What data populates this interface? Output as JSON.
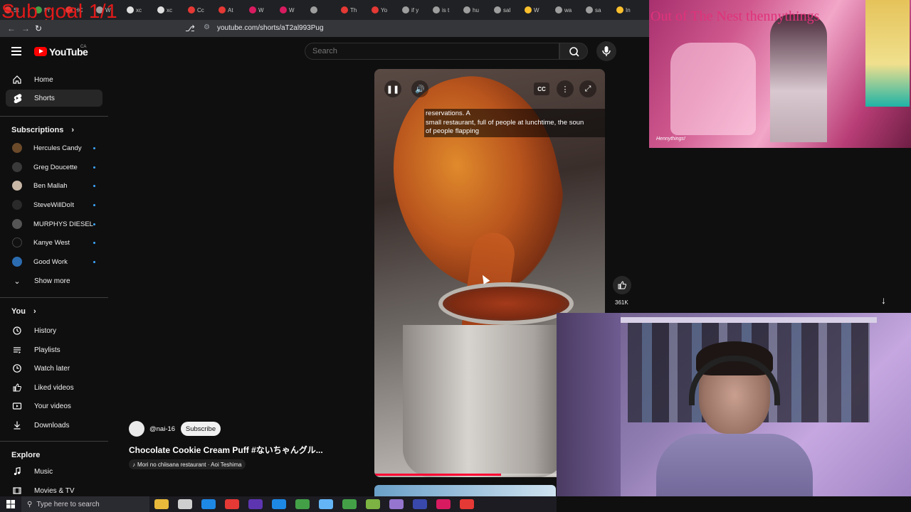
{
  "browser": {
    "tabs": [
      "St",
      "Pr",
      "HC",
      "W",
      "xc",
      "xc",
      "Cc",
      "At",
      "W",
      "W",
      "",
      "Th",
      "Yo",
      "if y",
      "is t",
      "hu",
      "sal",
      "W",
      "wa",
      "sa",
      "In"
    ],
    "url": "youtube.com/shorts/aT2al993Pug",
    "overlay_text": "Sub goal 1/1"
  },
  "youtube": {
    "logo": "YouTube",
    "region": "CA",
    "search_placeholder": "Search"
  },
  "sidebar": {
    "main": [
      {
        "label": "Home",
        "icon": "home-icon"
      },
      {
        "label": "Shorts",
        "icon": "shorts-icon"
      }
    ],
    "subscriptions_title": "Subscriptions",
    "subscriptions": [
      {
        "label": "Hercules Candy",
        "color": "#6b4a2a"
      },
      {
        "label": "Greg Doucette",
        "color": "#3a3a3a"
      },
      {
        "label": "Ben Mallah",
        "color": "#c9b7a6"
      },
      {
        "label": "SteveWillDoIt",
        "color": "#2a2a2a"
      },
      {
        "label": "MURPHYS DIESEL",
        "color": "#555555"
      },
      {
        "label": "Kanye West",
        "color": "#111111"
      },
      {
        "label": "Good Work",
        "color": "#2b6cb0"
      }
    ],
    "show_more": "Show more",
    "you_title": "You",
    "you_items": [
      {
        "label": "History",
        "icon": "history-icon"
      },
      {
        "label": "Playlists",
        "icon": "playlists-icon"
      },
      {
        "label": "Watch later",
        "icon": "watch-later-icon"
      },
      {
        "label": "Liked videos",
        "icon": "liked-videos-icon"
      },
      {
        "label": "Your videos",
        "icon": "your-videos-icon"
      },
      {
        "label": "Downloads",
        "icon": "downloads-icon"
      }
    ],
    "explore_title": "Explore",
    "explore_items": [
      {
        "label": "Music",
        "icon": "music-icon"
      },
      {
        "label": "Movies & TV",
        "icon": "movies-icon"
      }
    ]
  },
  "short": {
    "caption": "reservations. A\nsmall restaurant, full of people at lunchtime, the soun\nof people flapping",
    "progress": 0.55,
    "likes": "361K",
    "channel": "@nai-16",
    "subscribe": "Subscribe",
    "title": "Chocolate Cookie Cream Puff #ないちゃんグル...",
    "music": "Mori no chiisana restaurant · Aoi Teshima"
  },
  "overlays": {
    "top_text": "Out of The Nest thennythings",
    "signature": "Hennythings!"
  },
  "taskbar": {
    "search_placeholder": "Type here to search",
    "apps": [
      "#e8b93a",
      "#cfcfcf",
      "#1e88e5",
      "#e53935",
      "#5e35b1",
      "#1e88e5",
      "#43a047",
      "#64b5f6",
      "#43a047",
      "#7cb342",
      "#9575cd",
      "#3949ab",
      "#d81b60",
      "#e53935"
    ]
  },
  "colors": {
    "accent_red": "#ff0000",
    "subscription_dot": "#3ea6ff"
  }
}
